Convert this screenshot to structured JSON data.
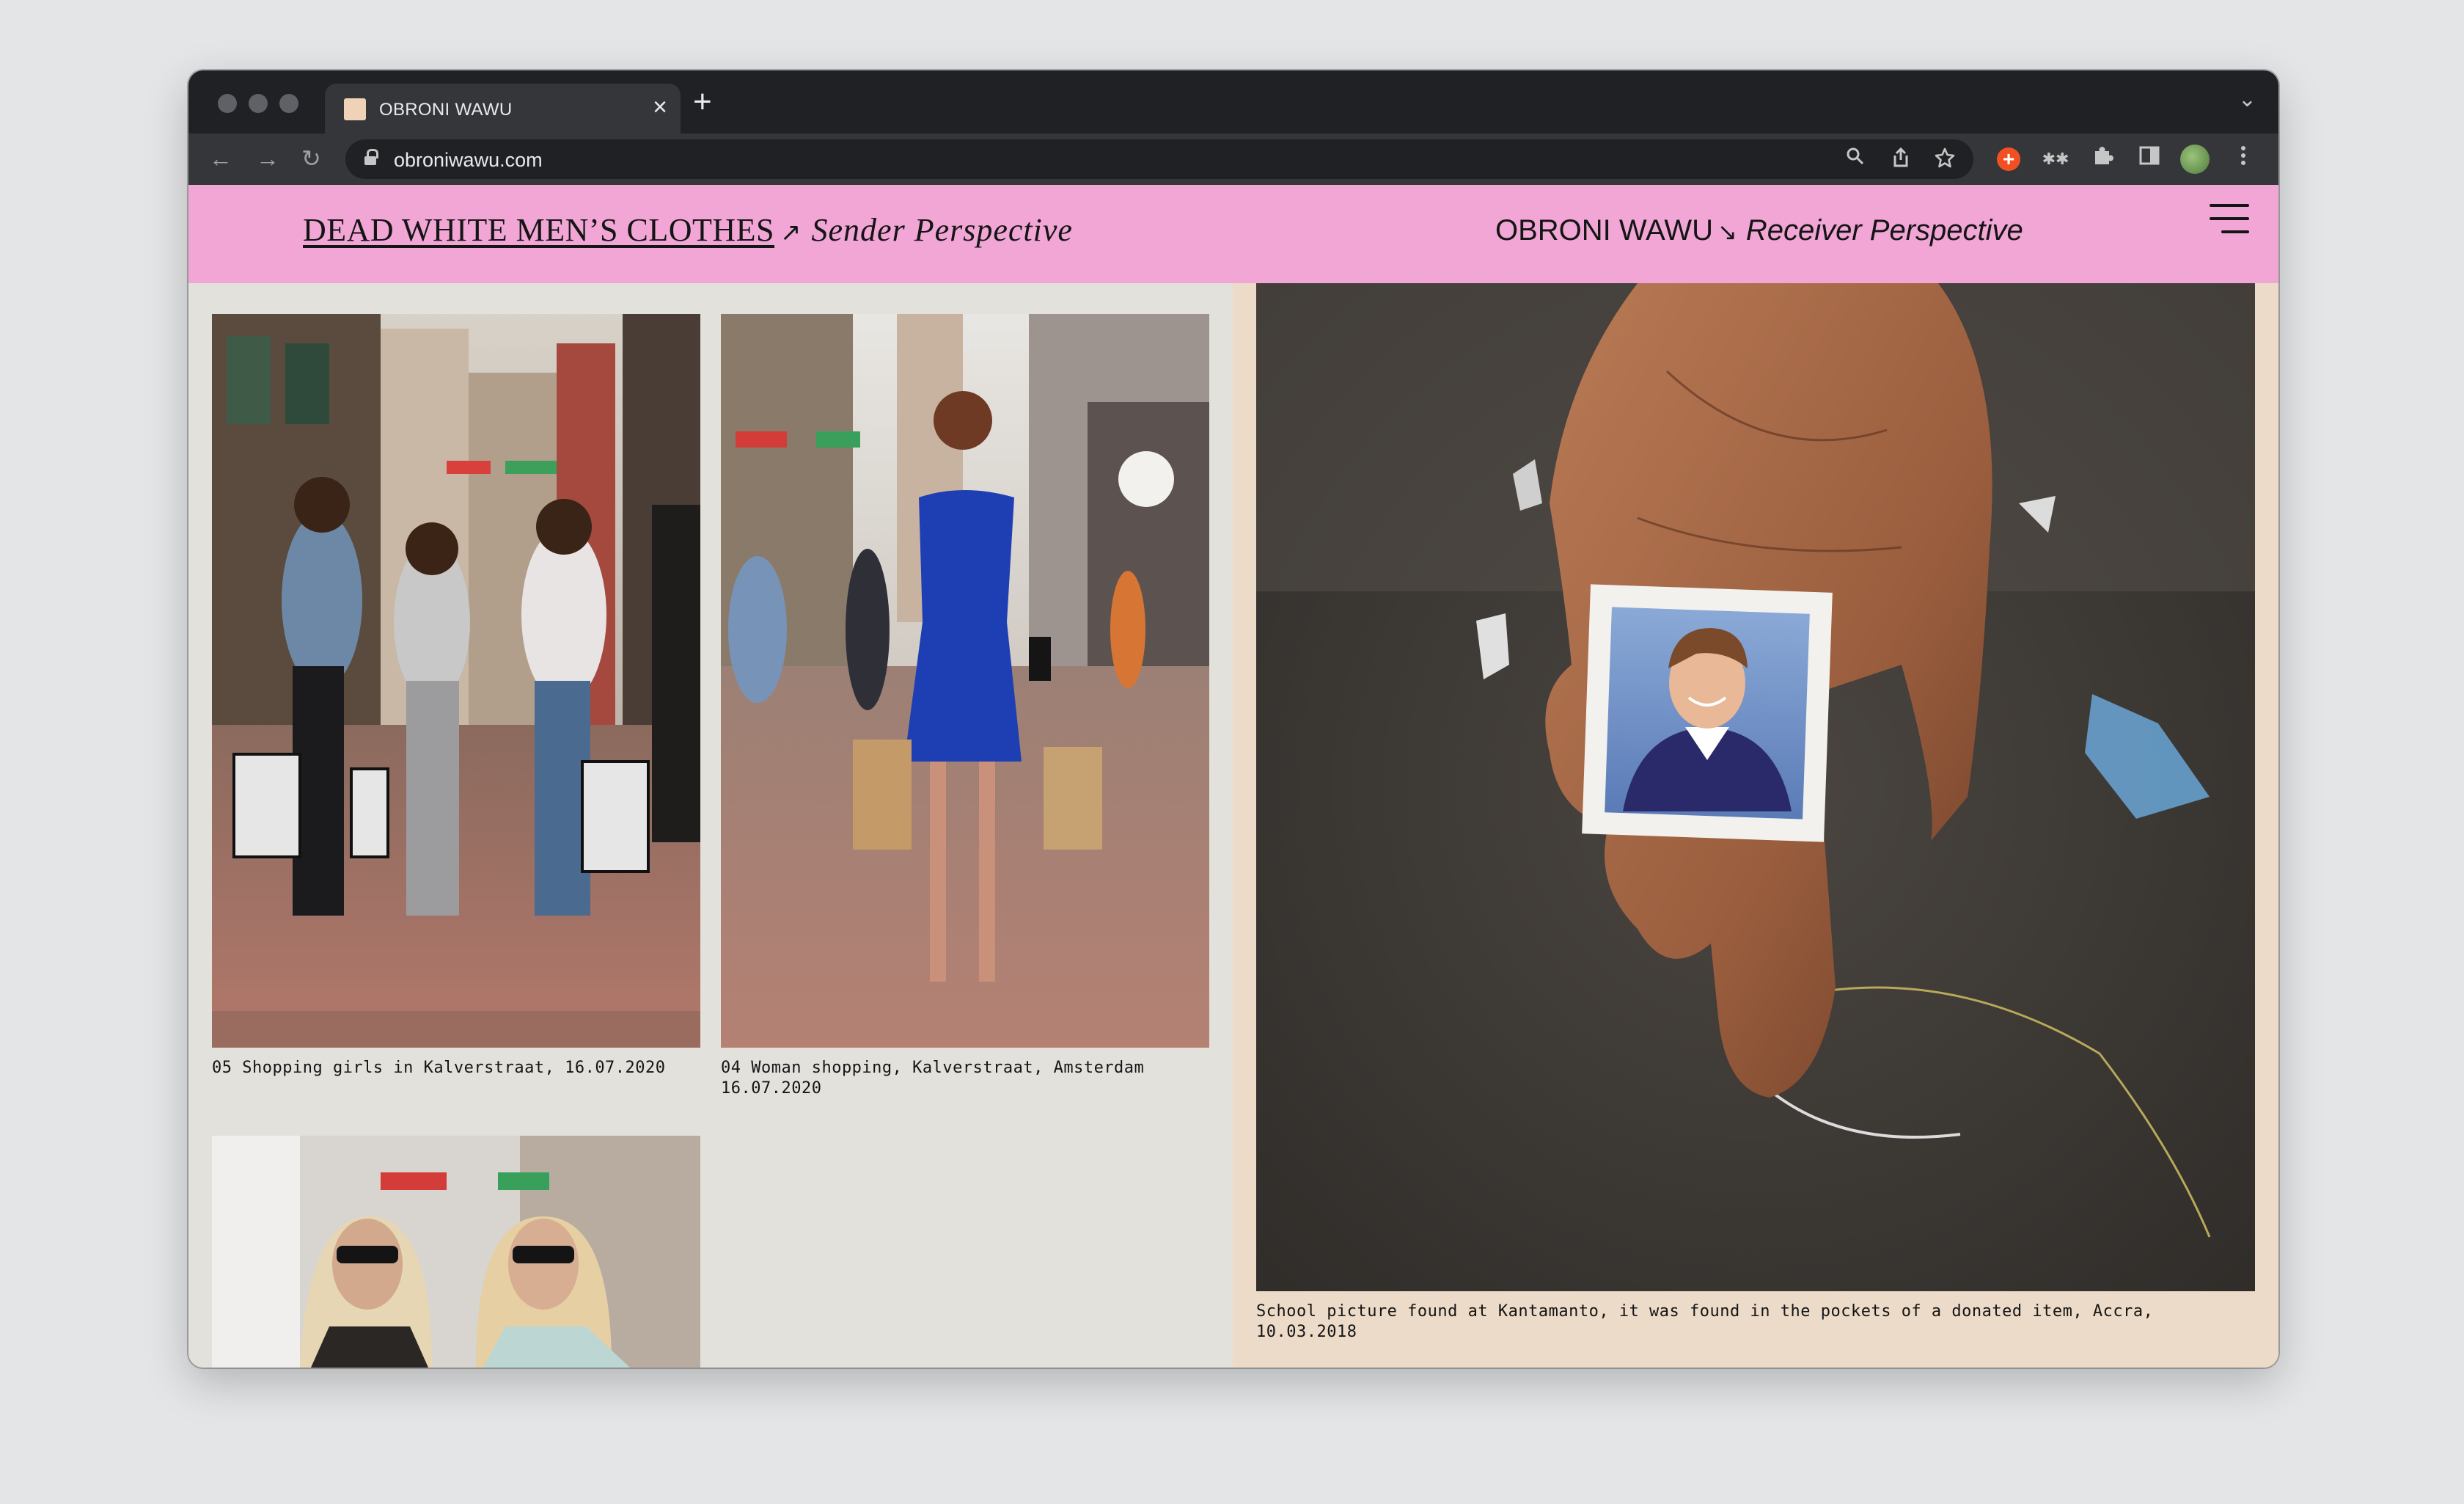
{
  "browser": {
    "tab_title": "OBRONI WAWU",
    "tab_close": "×",
    "new_tab": "+",
    "tab_menu": "⌄",
    "url": "obroniwawu.com",
    "nav_back": "←",
    "nav_forward": "→",
    "nav_reload": "↻",
    "icons": [
      "search-icon",
      "share-icon",
      "star-icon",
      "extension-orange-icon",
      "extension-mask-icon",
      "puzzle-icon",
      "sidebar-icon",
      "profile-avatar",
      "kebab-menu-icon"
    ]
  },
  "header": {
    "left_title": "DEAD WHITE MEN’S CLOTHES",
    "left_arrow": "↗",
    "left_subtitle": "Sender Perspective",
    "right_title": "OBRONI WAWU",
    "right_arrow": "↘",
    "right_subtitle": "Receiver Perspective",
    "colors": {
      "header_bg": "#f1a6d6",
      "left_bg": "#e2e1dc",
      "right_bg": "#ecdbc8"
    }
  },
  "photos": {
    "photo1": {
      "caption": "05 Shopping girls in Kalverstraat, 16.07.2020"
    },
    "photo2": {
      "caption": "04 Woman shopping, Kalverstraat, Amsterdam\n16.07.2020"
    },
    "photo3": {
      "caption": ""
    },
    "feature": {
      "caption": "School picture found at Kantamanto, it was found in the pockets of a donated item, Accra,\n10.03.2018"
    }
  }
}
